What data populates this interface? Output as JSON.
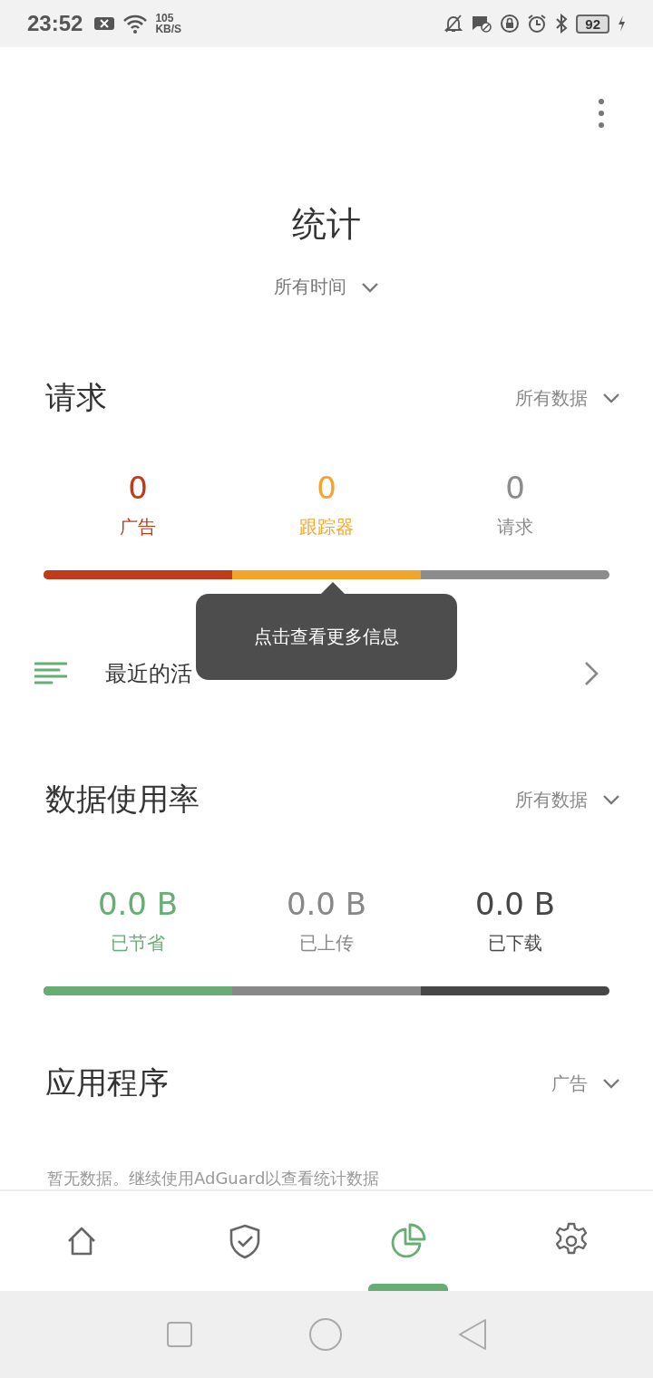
{
  "status_bar": {
    "time": "23:52",
    "net_speed": "105",
    "net_unit": "KB/S",
    "battery": "92"
  },
  "title": "统计",
  "period": {
    "label": "所有时间"
  },
  "requests": {
    "title": "请求",
    "filter": "所有数据",
    "stats": [
      {
        "value": "0",
        "label": "广告",
        "color": "#c23a1c",
        "level": 0.333
      },
      {
        "value": "0",
        "label": "跟踪器",
        "color": "#f3a52b",
        "level": 0.667
      },
      {
        "value": "0",
        "label": "请求",
        "color": "#8c8c8c"
      }
    ]
  },
  "tooltip": "点击查看更多信息",
  "recent_activity": {
    "label": "最近的活"
  },
  "data_usage": {
    "title": "数据使用率",
    "filter": "所有数据",
    "stats": [
      {
        "value": "0.0 B",
        "label": "已节省",
        "color": "#67ad74",
        "level": 0.333
      },
      {
        "value": "0.0 B",
        "label": "已上传",
        "color": "#888888",
        "level": 0.667
      },
      {
        "value": "0.0 B",
        "label": "已下载",
        "color": "#474747"
      }
    ]
  },
  "apps": {
    "title": "应用程序",
    "filter": "广告",
    "empty_text": "暂无数据。继续使用AdGuard以查看统计数据"
  },
  "bottom_nav": [
    {
      "kind": "home",
      "selected": false
    },
    {
      "kind": "shield",
      "selected": false
    },
    {
      "kind": "stats",
      "selected": true
    },
    {
      "kind": "settings",
      "selected": false
    }
  ]
}
